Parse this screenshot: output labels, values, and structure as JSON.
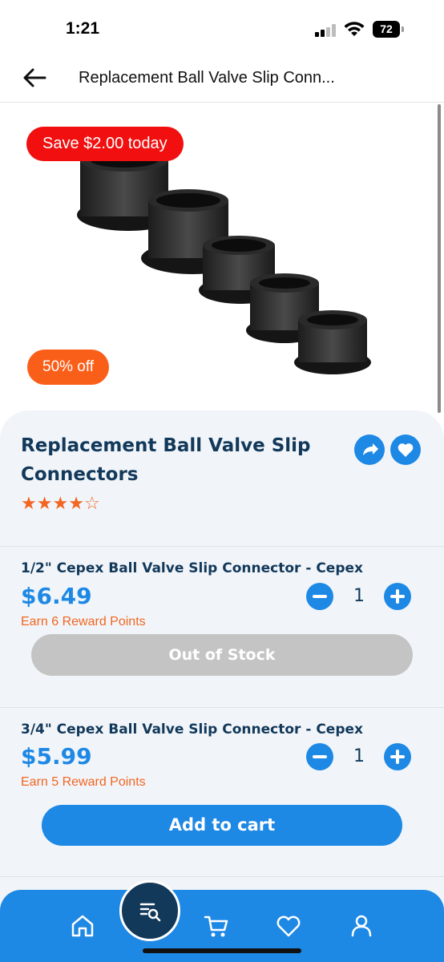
{
  "status": {
    "time": "1:21",
    "battery": "72"
  },
  "header": {
    "title": "Replacement Ball Valve Slip Conn..."
  },
  "badges": {
    "save": "Save $2.00 today",
    "discount": "50% off"
  },
  "product": {
    "title": "Replacement Ball Valve Slip Connectors",
    "rating_stars": 4,
    "rating_max": 5
  },
  "variants": [
    {
      "name": "1/2\" Cepex Ball Valve Slip Connector - Cepex",
      "price": "$6.49",
      "points": "Earn 6 Reward Points",
      "quantity": "1",
      "action": "Out of Stock"
    },
    {
      "name": "3/4\" Cepex Ball Valve Slip Connector - Cepex",
      "price": "$5.99",
      "points": "Earn 5 Reward Points",
      "quantity": "1",
      "action": "Add to cart"
    }
  ],
  "nav": {
    "items": [
      "home-icon",
      "search-list-icon",
      "cart-icon",
      "heart-icon",
      "user-icon"
    ]
  },
  "colors": {
    "accent": "#1e88e5",
    "navy": "#12385a",
    "orange": "#f26522",
    "red": "#f10f0f"
  }
}
